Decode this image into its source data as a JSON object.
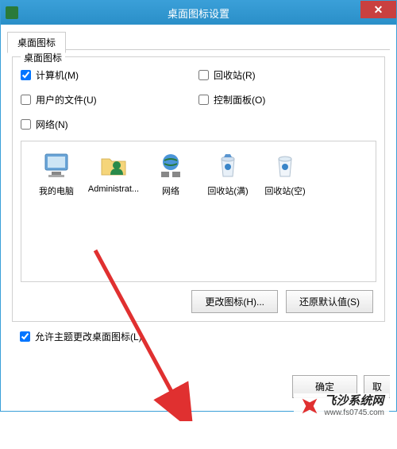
{
  "window": {
    "title": "桌面图标设置"
  },
  "tab": {
    "label": "桌面图标"
  },
  "group": {
    "label": "桌面图标"
  },
  "checkboxes": {
    "computer": {
      "label": "计算机(M)",
      "checked": true
    },
    "recyclebin": {
      "label": "回收站(R)",
      "checked": false
    },
    "userfiles": {
      "label": "用户的文件(U)",
      "checked": false
    },
    "controlpanel": {
      "label": "控制面板(O)",
      "checked": false
    },
    "network": {
      "label": "网络(N)",
      "checked": false
    }
  },
  "icons": [
    {
      "name": "my-computer",
      "label": "我的电脑"
    },
    {
      "name": "administrator",
      "label": "Administrat..."
    },
    {
      "name": "network",
      "label": "网络"
    },
    {
      "name": "recyclebin-full",
      "label": "回收站(满)"
    },
    {
      "name": "recyclebin-empty",
      "label": "回收站(空)"
    }
  ],
  "buttons": {
    "changeIcon": "更改图标(H)...",
    "restoreDefault": "还原默认值(S)",
    "ok": "确定",
    "cancel": "取"
  },
  "themeCheckbox": {
    "label": "允许主题更改桌面图标(L)",
    "checked": true
  },
  "watermark": {
    "title": "飞沙系统网",
    "url": "www.fs0745.com"
  }
}
